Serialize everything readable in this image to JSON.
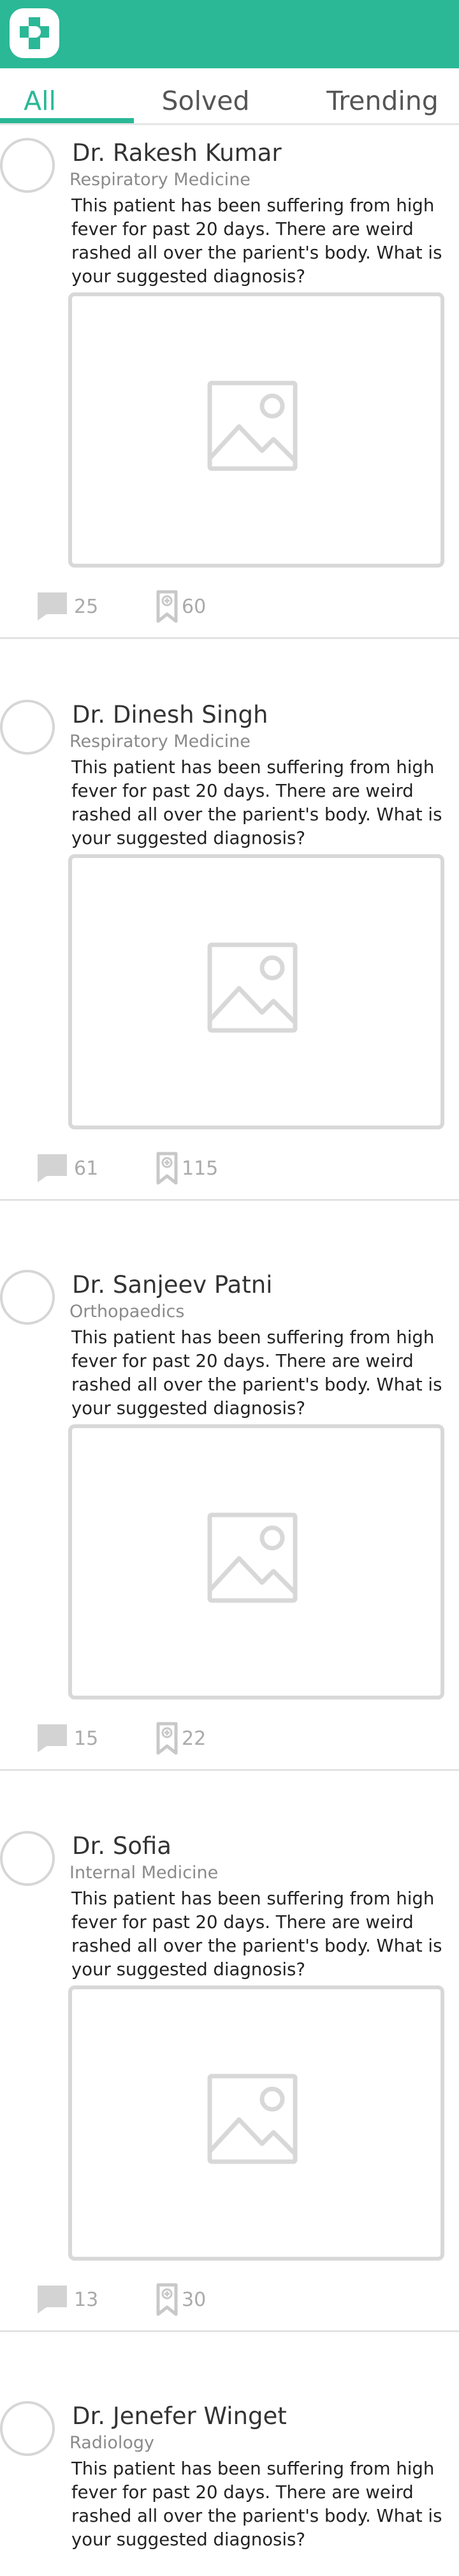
{
  "app": {
    "logo_icon": "medical-cross-icon",
    "brand_color": "#2ab896"
  },
  "tabs": [
    {
      "label": "All",
      "active": true
    },
    {
      "label": "Solved",
      "active": false
    },
    {
      "label": "Trending",
      "active": false
    }
  ],
  "posts": [
    {
      "name": "Dr. Rakesh Kumar",
      "specialty": "Respiratory Medicine",
      "text": "This patient has been suffering from high fever for past 20 days. There are weird rashed all over the parient's body. What is your suggested diagnosis?",
      "comments": "25",
      "bookmarks": "60"
    },
    {
      "name": "Dr. Dinesh Singh",
      "specialty": "Respiratory Medicine",
      "text": "This patient has been suffering from high fever for past 20 days. There are weird rashed all over the parient's body. What is your suggested diagnosis?",
      "comments": "61",
      "bookmarks": "115"
    },
    {
      "name": "Dr. Sanjeev Patni",
      "specialty": "Orthopaedics",
      "text": "This patient has been suffering from high fever for past 20 days. There are weird rashed all over the parient's body. What is your suggested diagnosis?",
      "comments": "15",
      "bookmarks": "22"
    },
    {
      "name": "Dr. Sofia",
      "specialty": "Internal Medicine",
      "text": "This patient has been suffering from high fever for past 20 days. There are weird rashed all over the parient's body. What is your suggested diagnosis?",
      "comments": "13",
      "bookmarks": "30"
    },
    {
      "name": "Dr. Jenefer Winget",
      "specialty": "Radiology",
      "text": "This patient has been suffering from high fever for past 20 days. There are weird rashed all over the parient's body. What is your suggested diagnosis?"
    }
  ]
}
